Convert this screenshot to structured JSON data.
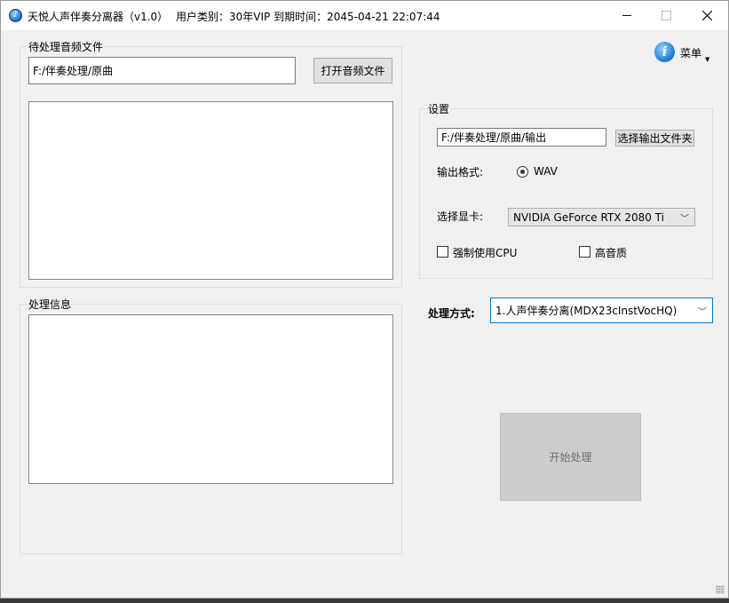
{
  "titlebar": {
    "title": "天悦人声伴奏分离器（v1.0）",
    "user_info": "用户类别：30年VIP 到期时间：2045-04-21 22:07:44",
    "minimize": "—",
    "maximize": "☐",
    "close": "✕"
  },
  "menu": {
    "label": "菜单",
    "caret": "▼"
  },
  "input_group": {
    "legend": "待处理音频文件",
    "path_value": "F:/伴奏处理/原曲",
    "open_button": "打开音频文件"
  },
  "info_group": {
    "legend": "处理信息"
  },
  "settings": {
    "legend": "设置",
    "output_path": "F:/伴奏处理/原曲/输出",
    "choose_output_button": "选择输出文件夹",
    "format_label": "输出格式:",
    "format_value": "WAV",
    "gpu_label": "选择显卡:",
    "gpu_value": "NVIDIA GeForce RTX 2080 Ti",
    "force_cpu_label": "强制使用CPU",
    "force_cpu_checked": false,
    "high_quality_label": "高音质",
    "high_quality_checked": false
  },
  "method": {
    "label": "处理方式:",
    "value": "1.人声伴奏分离(MDX23cInstVocHQ)"
  },
  "start_button": "开始处理",
  "icons": {
    "app": "app-music-icon",
    "info": "info-icon",
    "dropdown": "chevron-down-icon"
  }
}
